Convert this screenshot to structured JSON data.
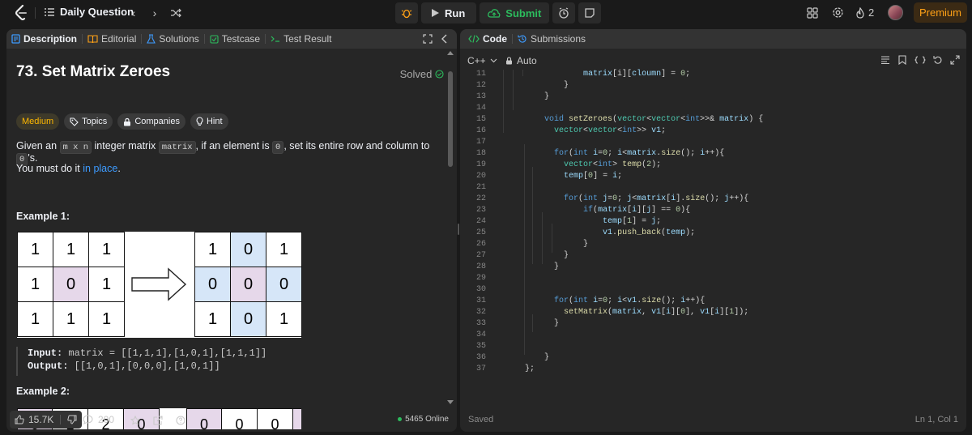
{
  "topbar": {
    "daily_question_label": "Daily Question",
    "run_label": "Run",
    "submit_label": "Submit",
    "streak_count": "2",
    "premium_label": "Premium"
  },
  "left_tabs": [
    "Description",
    "Editorial",
    "Solutions",
    "Testcase",
    "Test Result"
  ],
  "problem": {
    "title": "73. Set Matrix Zeroes",
    "status": "Solved",
    "difficulty": "Medium",
    "chips": [
      "Topics",
      "Companies",
      "Hint"
    ],
    "desc_before": "Given an",
    "desc_code1": "m x n",
    "desc_mid": "integer matrix",
    "desc_code2": "matrix",
    "desc_mid2": ", if an element is",
    "desc_code3": "0",
    "desc_mid3": ", set its entire row and column to",
    "desc_code4": "0",
    "desc_after": "'s.",
    "inplace_before": "You must do it",
    "inplace_link": "in place",
    "inplace_after": ".",
    "example1_heading": "Example 1:",
    "example1_grid_in": [
      [
        "1",
        "1",
        "1"
      ],
      [
        "1",
        "0",
        "1"
      ],
      [
        "1",
        "1",
        "1"
      ]
    ],
    "example1_grid_out": [
      [
        "1",
        "0",
        "1"
      ],
      [
        "0",
        "0",
        "0"
      ],
      [
        "1",
        "0",
        "1"
      ]
    ],
    "example1_input_label": "Input:",
    "example1_input_value": "matrix = [[1,1,1],[1,0,1],[1,1,1]]",
    "example1_output_label": "Output:",
    "example1_output_value": "[[1,0,1],[0,0,0],[1,0,1]]",
    "example2_heading": "Example 2:",
    "example2_in": [
      "0",
      "1",
      "2",
      "0"
    ],
    "example2_out": [
      "0",
      "0",
      "0",
      "0"
    ]
  },
  "bottom": {
    "likes": "15.7K",
    "comments": "200",
    "online": "5465 Online"
  },
  "right_tabs": [
    "Code",
    "Submissions"
  ],
  "editor": {
    "language": "C++",
    "mode": "Auto",
    "status_left": "Saved",
    "status_right": "Ln 1, Col 1",
    "line_numbers": [
      "11",
      "12",
      "13",
      "14",
      "15",
      "16",
      "17",
      "18",
      "19",
      "20",
      "21",
      "22",
      "23",
      "24",
      "25",
      "26",
      "27",
      "28",
      "29",
      "30",
      "31",
      "32",
      "33",
      "34",
      "35",
      "36",
      "37"
    ]
  },
  "colors": {
    "accent_orange": "#ffa116",
    "submit_green": "#2cbb5d",
    "medium_yellow": "#ffb800",
    "link_blue": "#3d9bff"
  }
}
